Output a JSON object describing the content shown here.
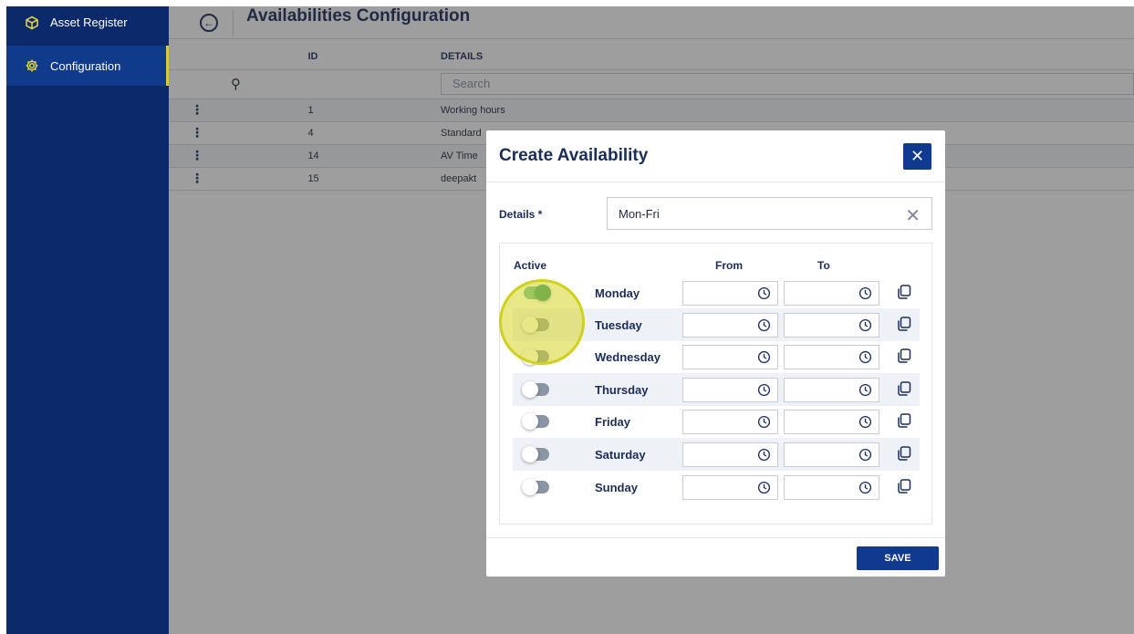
{
  "sidebar": {
    "items": [
      {
        "label": "Asset Register",
        "icon": "cube-icon"
      },
      {
        "label": "Configuration",
        "icon": "gear-icon"
      }
    ]
  },
  "header": {
    "back_icon": "back-arrow-circle-icon",
    "title": "Availabilities Configuration"
  },
  "grid": {
    "columns": [
      "ID",
      "DETAILS"
    ],
    "search_placeholder": "Search",
    "rows": [
      {
        "id": "1",
        "details": "Working hours"
      },
      {
        "id": "4",
        "details": "Standard"
      },
      {
        "id": "14",
        "details": "AV Time"
      },
      {
        "id": "15",
        "details": "deepakt"
      }
    ]
  },
  "modal": {
    "title": "Create Availability",
    "close_icon": "close-icon",
    "details_label": "Details *",
    "details_value": "Mon-Fri",
    "col_active": "Active",
    "col_from": "From",
    "col_to": "To",
    "days": [
      {
        "name": "Monday",
        "active": true
      },
      {
        "name": "Tuesday",
        "active": false
      },
      {
        "name": "Wednesday",
        "active": false
      },
      {
        "name": "Thursday",
        "active": false
      },
      {
        "name": "Friday",
        "active": false
      },
      {
        "name": "Saturday",
        "active": false
      },
      {
        "name": "Sunday",
        "active": false
      }
    ],
    "save_label": "SAVE"
  },
  "colors": {
    "sidebar_bg": "#0c2a6b",
    "primary": "#0f3a8f",
    "accent": "#d8c93a",
    "toggle_on": "#1a8c77",
    "highlight": "#cfd11c"
  }
}
